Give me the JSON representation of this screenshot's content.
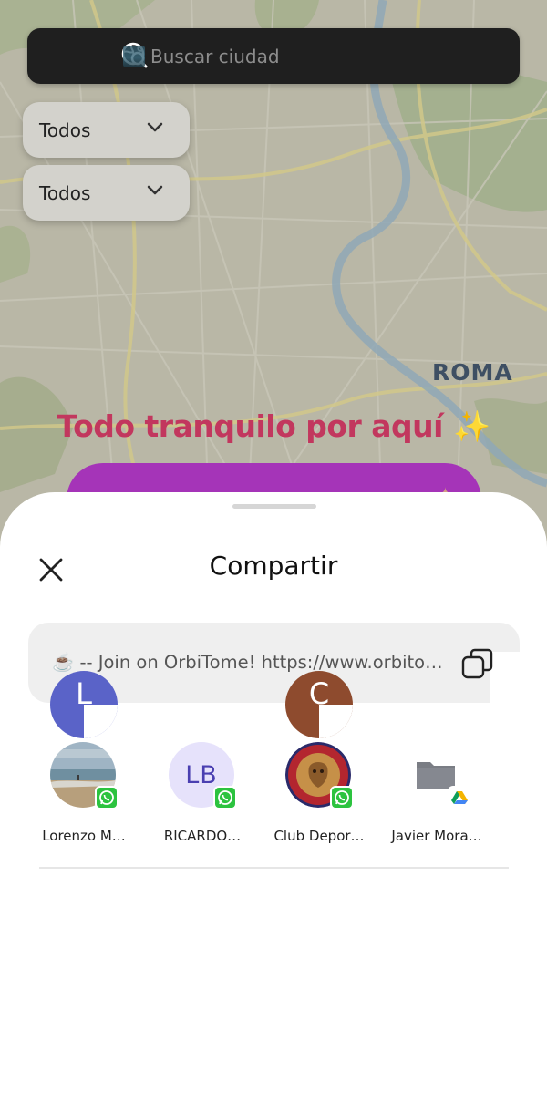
{
  "search": {
    "placeholder": "Buscar ciudad",
    "icon": "globe-search-icon"
  },
  "filters": [
    {
      "label": "Todos",
      "icon": "chevron-down-icon"
    },
    {
      "label": "Todos",
      "icon": "chevron-down-icon"
    }
  ],
  "map": {
    "city_label": "ROMA"
  },
  "empty_state": {
    "title": "Todo tranquilo por aquí ✨",
    "title_color": "#c2375e",
    "cta_color": "#a534b8"
  },
  "share_sheet": {
    "title": "Compartir",
    "close_icon": "close-icon",
    "share_text_emoji": "☕️",
    "share_text": "-- Join on OrbiTome! https://www.orbito…",
    "copy_icon": "copy-icon",
    "letter_avatars": [
      {
        "letter": "L",
        "color": "#5a63c8"
      },
      {
        "letter": "C",
        "color": "#8e4b2e"
      }
    ],
    "contacts": [
      {
        "name": "Lorenzo M…",
        "avatar": "beach-photo",
        "app": "whatsapp-icon"
      },
      {
        "name": "RICARDO…",
        "initials": "LB",
        "app": "whatsapp-icon"
      },
      {
        "name": "Club Depor…",
        "avatar": "club-crest-logo",
        "app": "whatsapp-icon"
      },
      {
        "name": "Javier Mora…",
        "avatar": "folder-icon",
        "app": "google-drive-icon"
      }
    ],
    "whatsapp_color": "#2cc33f"
  }
}
